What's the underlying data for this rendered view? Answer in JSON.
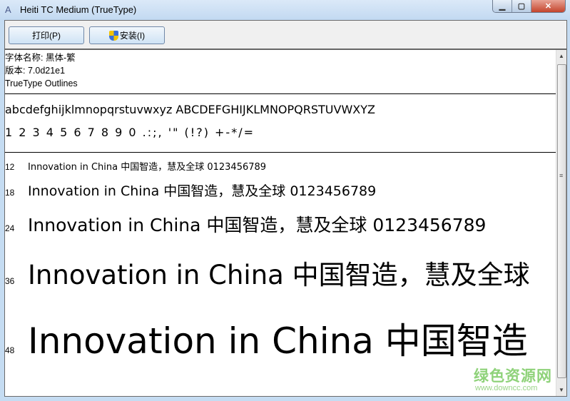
{
  "window": {
    "title": "Heiti TC Medium (TrueType)",
    "minimize": "▁",
    "maximize": "▢",
    "close": "✕"
  },
  "toolbar": {
    "print_label": "打印(P)",
    "install_label": "安装(I)"
  },
  "info": {
    "font_name": "字体名称: 黑体-繁",
    "version": "版本: 7.0d21e1",
    "outline": "TrueType Outlines"
  },
  "charset": {
    "letters": "abcdefghijklmnopqrstuvwxyz ABCDEFGHIJKLMNOPQRSTUVWXYZ",
    "symbols": "1 2 3 4 5 6 7 8 9 0 .:;, '\" (!?) +-*/="
  },
  "samples": [
    {
      "size": "12",
      "text": "Innovation in China 中国智造，慧及全球 0123456789"
    },
    {
      "size": "18",
      "text": "Innovation in China 中国智造，慧及全球 0123456789"
    },
    {
      "size": "24",
      "text": "Innovation in China 中国智造，慧及全球 0123456789"
    },
    {
      "size": "36",
      "text": "Innovation in China 中国智造，慧及全球"
    },
    {
      "size": "48",
      "text": "Innovation in China 中国智造"
    }
  ],
  "watermark": {
    "name": "绿色资源网",
    "url": "www.downcc.com"
  }
}
